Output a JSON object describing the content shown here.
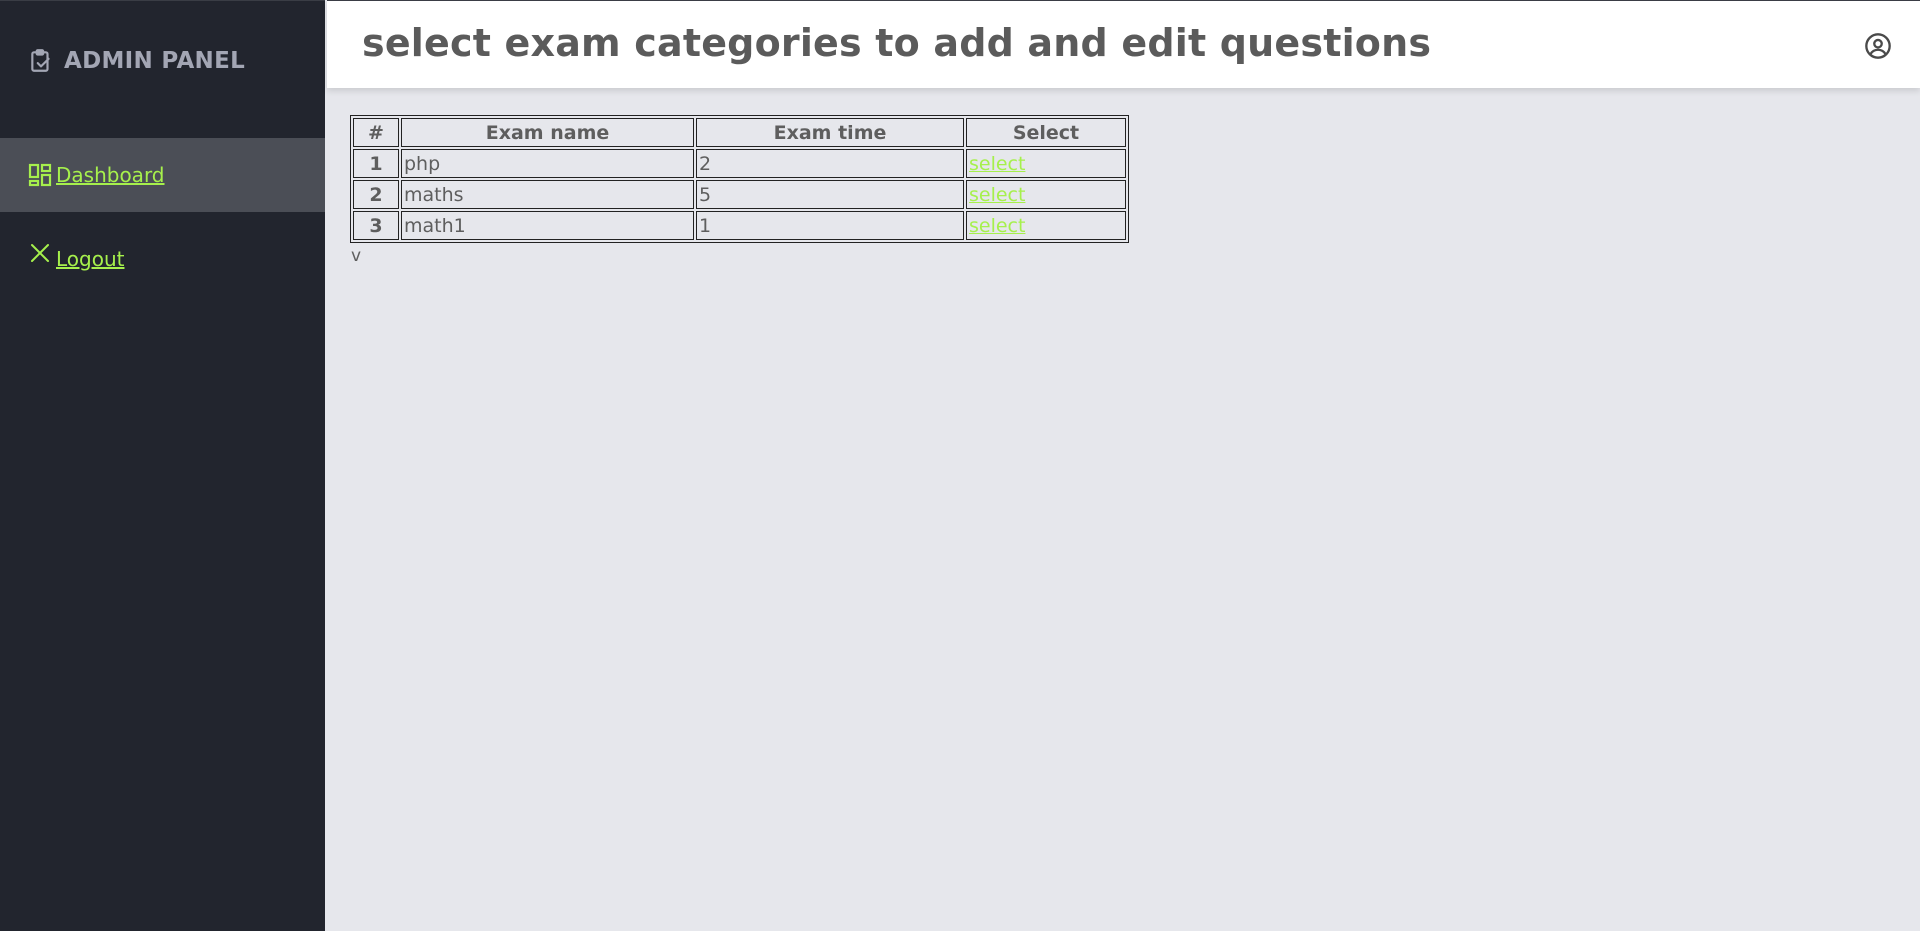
{
  "sidebar": {
    "brand": "ADMIN PANEL",
    "brand_icon": "clipboard-check-icon",
    "items": [
      {
        "label": " Dashboard",
        "icon": "dashboard-icon",
        "active": true
      },
      {
        "label": " Logout",
        "icon": "close-icon",
        "active": false
      }
    ]
  },
  "header": {
    "title": "select exam categories to add and edit questions",
    "user_icon": "user-circle-icon"
  },
  "table": {
    "headers": [
      "#",
      "Exam name",
      "Exam time",
      "Select"
    ],
    "rows": [
      {
        "num": "1",
        "name": "php",
        "time": "2",
        "action": "select"
      },
      {
        "num": "2",
        "name": "maths",
        "time": "5",
        "action": "select"
      },
      {
        "num": "3",
        "name": "math1",
        "time": "1",
        "action": "select"
      }
    ]
  },
  "stray_text": "v",
  "colors": {
    "sidebar_bg": "#22252e",
    "sidebar_active_bg": "#4b4e56",
    "accent_link": "#a6f04c",
    "page_bg": "#e6e7ec",
    "header_bg": "#ffffff",
    "text": "#5e5e5e"
  }
}
